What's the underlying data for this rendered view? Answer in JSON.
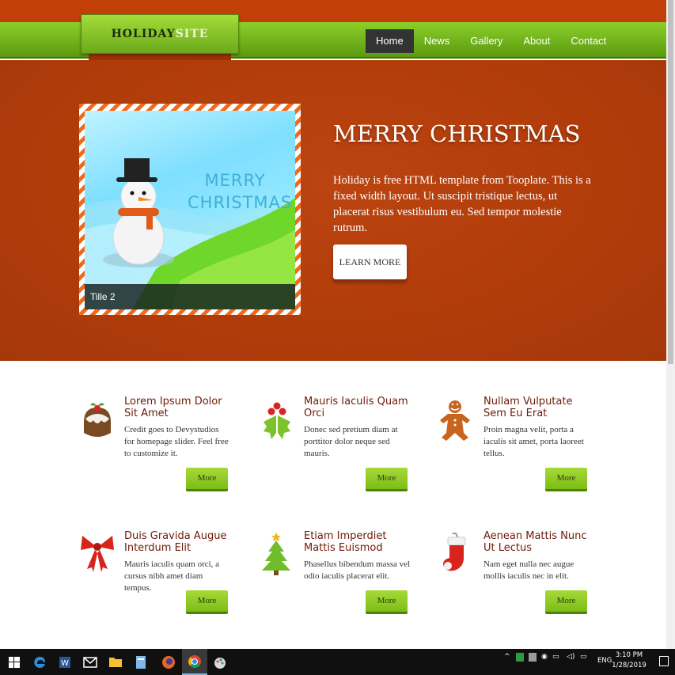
{
  "site": {
    "logo_part1": "HOLIDAY",
    "logo_part2": "SITE"
  },
  "nav": {
    "items": [
      {
        "label": "Home",
        "active": true
      },
      {
        "label": "News"
      },
      {
        "label": "Gallery"
      },
      {
        "label": "About"
      },
      {
        "label": "Contact"
      }
    ]
  },
  "hero": {
    "slide_text_line1": "MERRY",
    "slide_text_line2": "CHRISTMAS",
    "slide_caption": "Tille 2",
    "title": "MERRY CHRISTMAS",
    "body": "Holiday is free HTML template from Tooplate. This is a fixed width layout. Ut suscipit tristique lectus, ut placerat risus vestibulum eu. Sed tempor molestie rutrum.",
    "button_label": "LEARN MORE"
  },
  "features": [
    {
      "icon": "pudding-icon",
      "title": "Lorem Ipsum Dolor Sit Amet",
      "text": "Credit goes to Devystudios for homepage slider. Feel free to customize it.",
      "button": "More"
    },
    {
      "icon": "holly-icon",
      "title": "Mauris Iaculis Quam Orci",
      "text": "Donec sed pretium diam at porttitor dolor neque sed mauris.",
      "button": "More"
    },
    {
      "icon": "gingerbread-icon",
      "title": "Nullam Vulputate Sem Eu Erat",
      "text": "Proin magna velit, porta a iaculis sit amet, porta laoreet tellus.",
      "button": "More"
    },
    {
      "icon": "ribbon-bow-icon",
      "title": "Duis Gravida Augue Interdum Elit",
      "text": "Mauris iaculis quam orci, a cursus nibh amet diam tempus.",
      "button": "More"
    },
    {
      "icon": "christmas-tree-icon",
      "title": "Etiam Imperdiet Mattis Euismod",
      "text": "Phasellus bibendum massa vel odio iaculis placerat elit.",
      "button": "More"
    },
    {
      "icon": "stocking-icon",
      "title": "Aenean Mattis Nunc Ut Lectus",
      "text": "Nam eget nulla nec augue mollis iaculis nec in elit.",
      "button": "More"
    }
  ],
  "taskbar": {
    "language": "ENG",
    "time": "3:10 PM",
    "date": "1/28/2019"
  },
  "colors": {
    "hero_bg": "#b03c0a",
    "nav_green": "#6fb01c",
    "title_maroon": "#6e1a06",
    "button_green": "#8cc926"
  }
}
